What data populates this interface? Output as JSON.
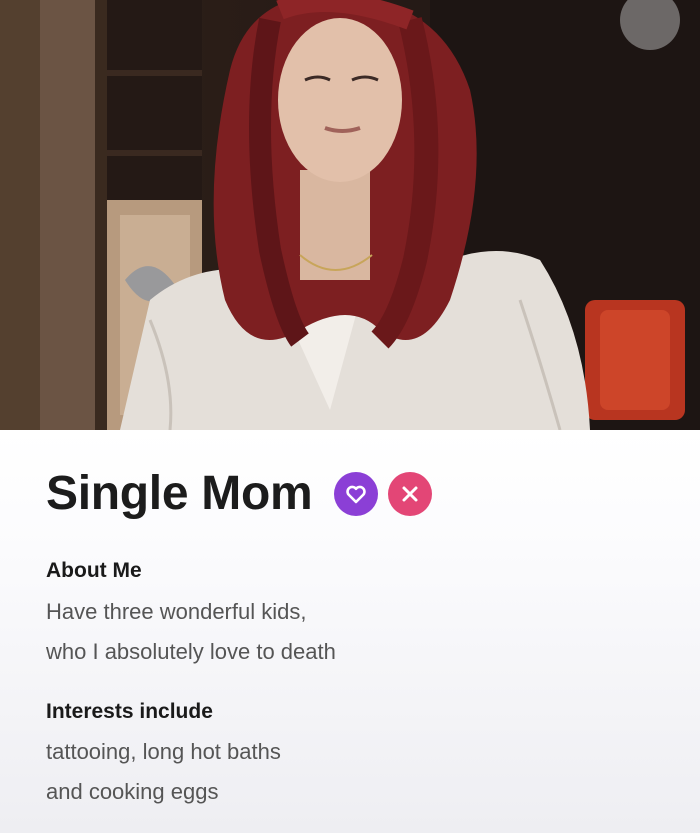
{
  "profile": {
    "name": "Single Mom",
    "about": {
      "heading": "About Me",
      "lines": [
        "Have three wonderful kids,",
        "who I absolutely love to death"
      ]
    },
    "interests": {
      "heading": "Interests include",
      "lines": [
        "tattooing, long hot baths",
        "and cooking eggs"
      ]
    }
  },
  "actions": {
    "like_icon": "heart-icon",
    "nope_icon": "x-icon"
  },
  "colors": {
    "like": "#8b3fd6",
    "nope": "#e34676",
    "hair": "#8a2424",
    "blouse": "#e8e3de"
  }
}
